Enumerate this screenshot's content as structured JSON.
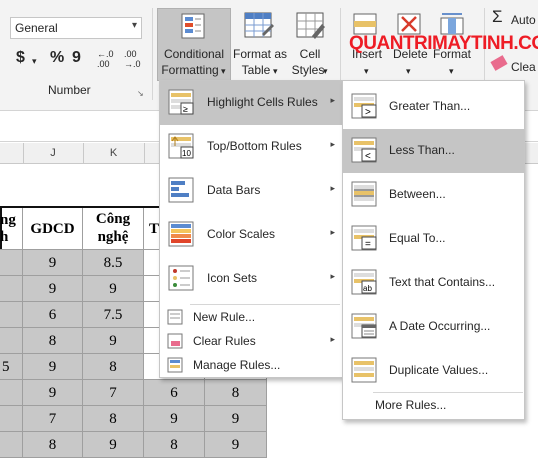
{
  "ribbon": {
    "number_format": "General",
    "dollar": "$",
    "dropdown_glyph": "▾",
    "percent": "%",
    "comma": "9",
    "inc_decimal": "←.0\n.00",
    "dec_decimal": ".00\n→.0",
    "number_group_label": "Number",
    "cf_label1": "Conditional",
    "cf_label2": "Formatting",
    "fat_label1": "Format as",
    "fat_label2": "Table",
    "cs_label1": "Cell",
    "cs_label2": "Styles",
    "insert": "Insert",
    "delete": "Delete",
    "format": "Format",
    "autosum": "Auto",
    "clear": "Clea",
    "sigma": "Σ"
  },
  "watermark": "QUANTRIMAYTINH.COM",
  "columns": [
    "J",
    "K"
  ],
  "table": {
    "headers": [
      "ng\nh",
      "GDCD",
      "Công\nnghệ",
      "T"
    ],
    "rows": [
      [
        "",
        "9",
        "8.5",
        "",
        ""
      ],
      [
        "",
        "9",
        "9",
        "",
        ""
      ],
      [
        "",
        "6",
        "7.5",
        "",
        ""
      ],
      [
        "",
        "8",
        "9",
        "",
        ""
      ],
      [
        "5",
        "9",
        "8",
        "",
        ""
      ],
      [
        "",
        "9",
        "7",
        "6",
        "8"
      ],
      [
        "",
        "7",
        "8",
        "9",
        "9"
      ],
      [
        "",
        "8",
        "9",
        "8",
        "9"
      ]
    ]
  },
  "cf_menu": {
    "items": [
      {
        "label": "Highlight Cells Rules",
        "icon": "highlight-cells-icon",
        "highlighted": true
      },
      {
        "label": "Top/Bottom Rules",
        "icon": "top-bottom-icon",
        "highlighted": false
      },
      {
        "label": "Data Bars",
        "icon": "data-bars-icon",
        "highlighted": false
      },
      {
        "label": "Color Scales",
        "icon": "color-scales-icon",
        "highlighted": false
      },
      {
        "label": "Icon Sets",
        "icon": "icon-sets-icon",
        "highlighted": false
      }
    ],
    "small_items": [
      {
        "label": "New Rule...",
        "icon": "new-rule-icon"
      },
      {
        "label": "Clear Rules",
        "icon": "clear-rules-icon"
      },
      {
        "label": "Manage Rules...",
        "icon": "manage-rules-icon"
      }
    ],
    "submenu_arrow": "▸"
  },
  "hcr_menu": {
    "items": [
      {
        "label": "Greater Than...",
        "icon": "greater-than-icon",
        "highlighted": false
      },
      {
        "label": "Less Than...",
        "icon": "less-than-icon",
        "highlighted": true
      },
      {
        "label": "Between...",
        "icon": "between-icon",
        "highlighted": false
      },
      {
        "label": "Equal To...",
        "icon": "equal-to-icon",
        "highlighted": false
      },
      {
        "label": "Text that Contains...",
        "icon": "text-contains-icon",
        "highlighted": false
      },
      {
        "label": "A Date Occurring...",
        "icon": "date-occurring-icon",
        "highlighted": false
      },
      {
        "label": "Duplicate Values...",
        "icon": "duplicate-values-icon",
        "highlighted": false
      }
    ],
    "more": "More Rules..."
  },
  "colors": {
    "excel_green": "#217346",
    "highlight": "#c5c5c5",
    "cell_gray": "#c8c8c8",
    "watermark_red": "#ee1c25"
  }
}
